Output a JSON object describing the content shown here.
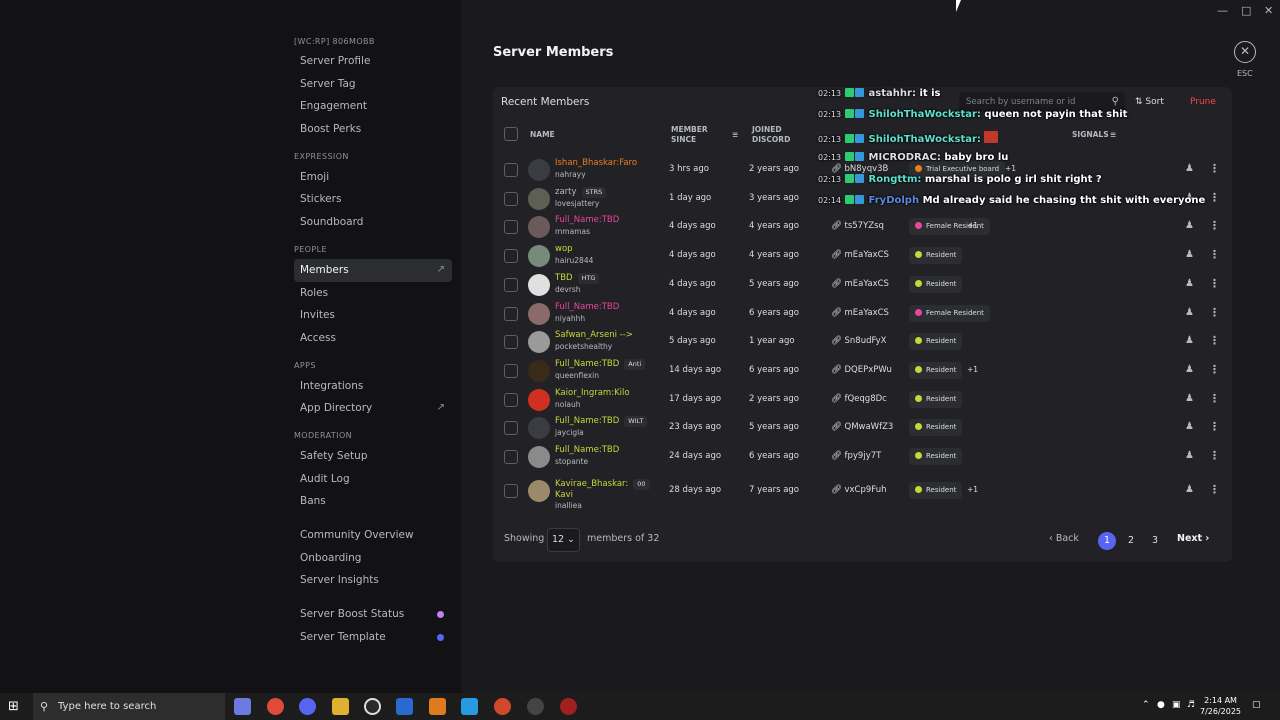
{
  "sidebar": {
    "server_label": "[WC:RP] 806MOBB",
    "group1": [
      "Server Profile",
      "Server Tag",
      "Engagement",
      "Boost Perks"
    ],
    "cat_expression": "EXPRESSION",
    "group2": [
      "Emoji",
      "Stickers",
      "Soundboard"
    ],
    "cat_people": "PEOPLE",
    "group3": [
      "Members",
      "Roles",
      "Invites",
      "Access"
    ],
    "cat_apps": "APPS",
    "group4": [
      "Integrations",
      "App Directory"
    ],
    "cat_moderation": "MODERATION",
    "group5": [
      "Safety Setup",
      "Audit Log",
      "Bans"
    ],
    "group6": [
      "Community Overview",
      "Onboarding",
      "Server Insights"
    ],
    "group7": [
      "Server Boost Status",
      "Server Template"
    ],
    "boost_dot_color": "#c47ff5",
    "template_dot_color": "#5865f2"
  },
  "main": {
    "title": "Server Members",
    "esc": "ESC",
    "panel_title": "Recent Members",
    "search_placeholder": "Search by username or id",
    "sort": "Sort",
    "prune": "Prune",
    "columns": {
      "name": "NAME",
      "member_since_1": "MEMBER",
      "member_since_2": "SINCE",
      "joined_1": "JOINED",
      "joined_2": "DISCORD",
      "signals": "SIGNALS"
    },
    "members": [
      {
        "name": "Ishan_Bhaskar:Faro",
        "user": "nahrayy",
        "since": "3 hrs ago",
        "joined": "2 years ago",
        "link": "bN8yqv3B",
        "role": "Trial Executive board",
        "role_color": "#e67e22",
        "extra": "+1",
        "name_color": "#e67e22",
        "avatar": "#3a3c42",
        "tag": ""
      },
      {
        "name": "zarty",
        "user": "lovesjattery",
        "since": "1 day ago",
        "joined": "3 years ago",
        "link": "",
        "role": "",
        "role_color": "",
        "extra": "",
        "name_color": "#b5bac1",
        "avatar": "#5d5f55",
        "tag": "STRS"
      },
      {
        "name": "Full_Name:TBD",
        "user": "mmamas",
        "since": "4 days ago",
        "joined": "4 years ago",
        "link": "ts57YZsq",
        "role": "Female Resident",
        "role_color": "#eb459e",
        "extra": "+1",
        "name_color": "#eb459e",
        "avatar": "#6a5a5a",
        "tag": ""
      },
      {
        "name": "wop",
        "user": "hairu2844",
        "since": "4 days ago",
        "joined": "4 years ago",
        "link": "mEaYaxCS",
        "role": "Resident",
        "role_color": "#c9d63a",
        "extra": "",
        "name_color": "#c9d63a",
        "avatar": "#7a8a7a",
        "tag": ""
      },
      {
        "name": "TBD",
        "user": "devrsh",
        "since": "4 days ago",
        "joined": "5 years ago",
        "link": "mEaYaxCS",
        "role": "Resident",
        "role_color": "#c9d63a",
        "extra": "",
        "name_color": "#c9d63a",
        "avatar": "#e0e0e0",
        "tag": "HTG"
      },
      {
        "name": "Full_Name:TBD",
        "user": "niyahhh",
        "since": "4 days ago",
        "joined": "6 years ago",
        "link": "mEaYaxCS",
        "role": "Female Resident",
        "role_color": "#eb459e",
        "extra": "",
        "name_color": "#eb459e",
        "avatar": "#8a6a6a",
        "tag": ""
      },
      {
        "name": "Safwan_Arseni -->",
        "user": "pocketshealthy",
        "since": "5 days ago",
        "joined": "1 year ago",
        "link": "Sn8udFyX",
        "role": "Resident",
        "role_color": "#c9d63a",
        "extra": "",
        "name_color": "#c9d63a",
        "avatar": "#9a9a9a",
        "tag": ""
      },
      {
        "name": "Full_Name:TBD",
        "user": "queenflexin",
        "since": "14 days ago",
        "joined": "6 years ago",
        "link": "DQEPxPWu",
        "role": "Resident",
        "role_color": "#c9d63a",
        "extra": "+1",
        "name_color": "#c9d63a",
        "avatar": "#3a2a1a",
        "tag": "Anti"
      },
      {
        "name": "Kaior_Ingram:Kilo",
        "user": "nolauh",
        "since": "17 days ago",
        "joined": "2 years ago",
        "link": "fQeqg8Dc",
        "role": "Resident",
        "role_color": "#c9d63a",
        "extra": "",
        "name_color": "#c9d63a",
        "avatar": "#d03020",
        "tag": ""
      },
      {
        "name": "Full_Name:TBD",
        "user": "jaycigla",
        "since": "23 days ago",
        "joined": "5 years ago",
        "link": "QMwaWfZ3",
        "role": "Resident",
        "role_color": "#c9d63a",
        "extra": "",
        "name_color": "#c9d63a",
        "avatar": "#3a3c42",
        "tag": "WILT"
      },
      {
        "name": "Full_Name:TBD",
        "user": "stopante",
        "since": "24 days ago",
        "joined": "6 years ago",
        "link": "fpy9jy7T",
        "role": "Resident",
        "role_color": "#c9d63a",
        "extra": "",
        "name_color": "#c9d63a",
        "avatar": "#8a8a8a",
        "tag": ""
      },
      {
        "name": "Kavirae_Bhaskar:",
        "name2": "Kavi",
        "user": "inalliea",
        "since": "28 days ago",
        "joined": "7 years ago",
        "link": "vxCp9Fuh",
        "role": "Resident",
        "role_color": "#c9d63a",
        "extra": "+1",
        "name_color": "#c9d63a",
        "avatar": "#9a8a6a",
        "tag": "00"
      }
    ],
    "pager": {
      "showing": "Showing",
      "page_size": "12",
      "of_text": "members of 32",
      "back": "Back",
      "pages": [
        "1",
        "2",
        "3"
      ],
      "next": "Next"
    }
  },
  "chat": [
    {
      "time": "02:13",
      "user": "astahhr:",
      "msg": "it is",
      "user_color": "#dbdee1"
    },
    {
      "time": "02:13",
      "user": "ShilohThaWockstar:",
      "msg": "queen not payin that shit",
      "user_color": "#5ee0d0"
    },
    {
      "time": "02:13",
      "user": "ShilohThaWockstar:",
      "msg": "",
      "user_color": "#5ee0d0"
    },
    {
      "time": "02:13",
      "user": "MICRODRAC:",
      "msg": "baby bro lu",
      "user_color": "#dbdee1"
    },
    {
      "time": "02:13",
      "user": "Rongttm:",
      "msg": "marshal is polo g irl shit right ?",
      "user_color": "#5ee0d0"
    },
    {
      "time": "02:14",
      "user": "FryDolph",
      "msg": "Md already said he chasing tht shit with everyone",
      "user_color": "#5a8ae0"
    }
  ],
  "taskbar": {
    "search": "Type here to search",
    "time": "2:14 AM",
    "date": "7/26/2025"
  }
}
